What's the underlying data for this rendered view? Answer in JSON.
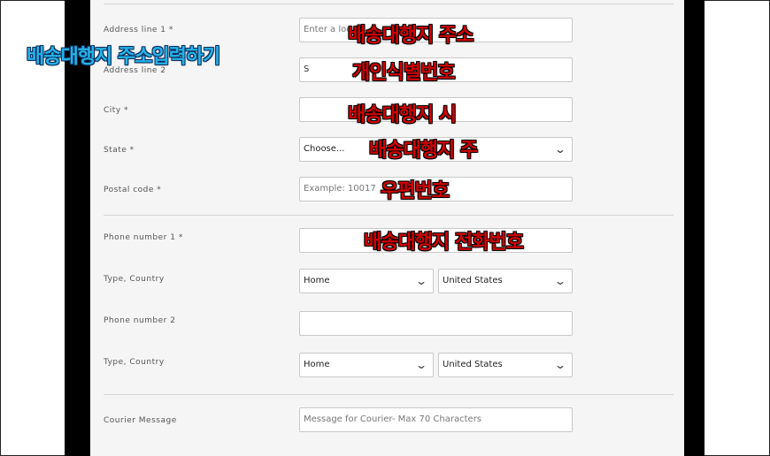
{
  "annotation_title": "배송대행지 주소입력하기",
  "form": {
    "address1": {
      "label": "Address line 1 *",
      "placeholder": "Enter a loca",
      "note": "배송대행지 주소"
    },
    "address2": {
      "label": "Address line 2",
      "value": "S",
      "note": "개인식별번호"
    },
    "city": {
      "label": "City *",
      "note": "배송대행지 시"
    },
    "state": {
      "label": "State *",
      "value": "Choose...",
      "note": "배송대행지 주"
    },
    "postal": {
      "label": "Postal code *",
      "placeholder": "Example: 10017",
      "note": "우편번호"
    },
    "phone1": {
      "label": "Phone number 1 *",
      "note": "배송대행지 전화번호"
    },
    "type1": {
      "label": "Type, Country",
      "type_value": "Home",
      "country_value": "United States"
    },
    "phone2": {
      "label": "Phone number 2"
    },
    "type2": {
      "label": "Type, Country",
      "type_value": "Home",
      "country_value": "United States"
    },
    "courier": {
      "label": "Courier Message",
      "placeholder": "Message for Courier- Max 70 Characters"
    }
  },
  "colors": {
    "overlay_red": "#d10000",
    "overlay_blue": "#25b3e8"
  }
}
